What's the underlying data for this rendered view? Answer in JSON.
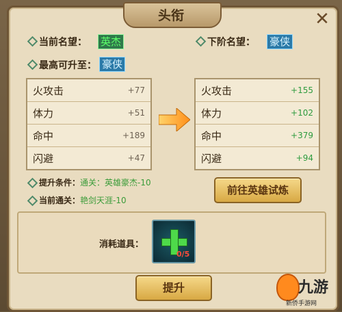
{
  "window": {
    "title": "头衔",
    "close_icon": "close-icon"
  },
  "current": {
    "label": "当前名望：",
    "value": "英杰"
  },
  "next": {
    "label": "下阶名望：",
    "value": "豪侠"
  },
  "max": {
    "label": "最高可升至：",
    "value": "豪侠"
  },
  "current_stats": [
    {
      "name": "火攻击",
      "value": "+77"
    },
    {
      "name": "体力",
      "value": "+51"
    },
    {
      "name": "命中",
      "value": "+189"
    },
    {
      "name": "闪避",
      "value": "+47"
    }
  ],
  "next_stats": [
    {
      "name": "火攻击",
      "value": "+155"
    },
    {
      "name": "体力",
      "value": "+102"
    },
    {
      "name": "命中",
      "value": "+379"
    },
    {
      "name": "闪避",
      "value": "+94"
    }
  ],
  "conditions": {
    "upgrade_label": "提升条件：",
    "upgrade_value": "通关：英雄豪杰-10",
    "current_label": "当前通关：",
    "current_value": "艳剑天涯-10"
  },
  "buttons": {
    "trial": "前往英雄试炼",
    "upgrade": "提升"
  },
  "consume": {
    "label": "消耗道具：",
    "item_icon": "green-plus-icon",
    "quantity": "0/5"
  },
  "logo": {
    "name": "九游",
    "sub": "新侨手游网"
  },
  "colors": {
    "green_badge": "#2f7a4a",
    "blue_badge": "#2b7aa8",
    "button": "#d8a944",
    "stat_up": "#2e9b3e"
  }
}
